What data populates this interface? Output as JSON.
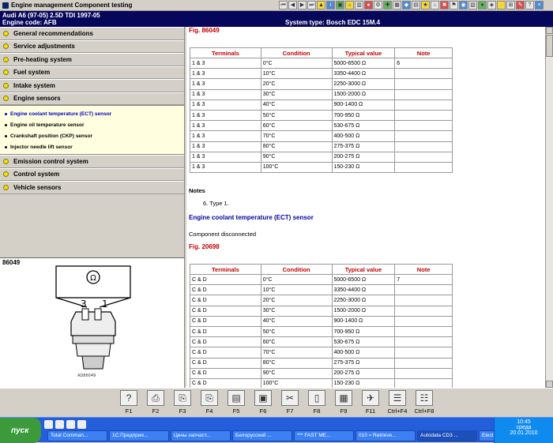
{
  "window": {
    "title": "Engine management Component testing"
  },
  "vehicle": {
    "line1": "Audi   A6 (97-05) 2.5D TDI 1997-05",
    "line2": "Engine code: AFB",
    "system_type": "System type: Bosch EDC 15M.4"
  },
  "nav": {
    "items_top": [
      {
        "label": "General recommendations"
      },
      {
        "label": "Service adjustments"
      },
      {
        "label": "Pre-heating system"
      },
      {
        "label": "Fuel system"
      },
      {
        "label": "Intake system"
      },
      {
        "label": "Engine sensors"
      }
    ],
    "subitems": [
      {
        "label": "Engine coolant temperature (ECT) sensor"
      },
      {
        "label": "Engine oil temperature sensor"
      },
      {
        "label": "Crankshaft position (CKP) sensor"
      },
      {
        "label": "Injector needle lift sensor"
      }
    ],
    "items_bottom": [
      {
        "label": "Emission control system"
      },
      {
        "label": "Control system"
      },
      {
        "label": "Vehicle sensors"
      }
    ]
  },
  "figure_panel": {
    "label": "86049",
    "pin3": "3",
    "pin1": "1",
    "ohm": "Ω",
    "caption": "AD86049"
  },
  "content": {
    "fig1": "Fig. 86049",
    "table1": {
      "headers": [
        "Terminals",
        "Condition",
        "Typical value",
        "Note"
      ],
      "rows": [
        [
          "1 & 3",
          "0°C",
          "5000-6500 Ω",
          "6"
        ],
        [
          "1 & 3",
          "10°C",
          "3350-4400 Ω",
          ""
        ],
        [
          "1 & 3",
          "20°C",
          "2250-3000 Ω",
          ""
        ],
        [
          "1 & 3",
          "30°C",
          "1500-2000 Ω",
          ""
        ],
        [
          "1 & 3",
          "40°C",
          "900-1400 Ω",
          ""
        ],
        [
          "1 & 3",
          "50°C",
          "700-950 Ω",
          ""
        ],
        [
          "1 & 3",
          "60°C",
          "530-675 Ω",
          ""
        ],
        [
          "1 & 3",
          "70°C",
          "400-500 Ω",
          ""
        ],
        [
          "1 & 3",
          "80°C",
          "275-375 Ω",
          ""
        ],
        [
          "1 & 3",
          "90°C",
          "200-275 Ω",
          ""
        ],
        [
          "1 & 3",
          "100°C",
          "150-230 Ω",
          ""
        ]
      ]
    },
    "notes_heading": "Notes",
    "note_item": "6. Type 1.",
    "section_heading": "Engine coolant temperature (ECT) sensor",
    "component_text": "Component disconnected",
    "fig2": "Fig. 20698",
    "table2": {
      "headers": [
        "Terminals",
        "Condition",
        "Typical value",
        "Note"
      ],
      "rows": [
        [
          "C & D",
          "0°C",
          "5000-6500 Ω",
          "7"
        ],
        [
          "C & D",
          "10°C",
          "3350-4400 Ω",
          ""
        ],
        [
          "C & D",
          "20°C",
          "2250-3000 Ω",
          ""
        ],
        [
          "C & D",
          "30°C",
          "1500-2000 Ω",
          ""
        ],
        [
          "C & D",
          "40°C",
          "900-1400 Ω",
          ""
        ],
        [
          "C & D",
          "50°C",
          "700-950 Ω",
          ""
        ],
        [
          "C & D",
          "60°C",
          "530-675 Ω",
          ""
        ],
        [
          "C & D",
          "70°C",
          "400-500 Ω",
          ""
        ],
        [
          "C & D",
          "80°C",
          "275-375 Ω",
          ""
        ],
        [
          "C & D",
          "90°C",
          "200-275 Ω",
          ""
        ],
        [
          "C & D",
          "100°C",
          "150-230 Ω",
          ""
        ]
      ]
    }
  },
  "fkeys": [
    {
      "label": "F1",
      "icon": "?"
    },
    {
      "label": "F2",
      "icon": "⎙"
    },
    {
      "label": "F3",
      "icon": "⎘"
    },
    {
      "label": "F4",
      "icon": "⎘"
    },
    {
      "label": "F5",
      "icon": "▤"
    },
    {
      "label": "F6",
      "icon": "▣"
    },
    {
      "label": "F7",
      "icon": "✂"
    },
    {
      "label": "F8",
      "icon": "▯"
    },
    {
      "label": "F9",
      "icon": "▦"
    },
    {
      "label": "F11",
      "icon": "✈"
    },
    {
      "label": "Ctrl+F4",
      "icon": "☰"
    },
    {
      "label": "Ctrl+F8",
      "icon": "☷"
    }
  ],
  "taskbar": {
    "start": "пуск",
    "tasks": [
      "Total Comman...",
      "1С:Предприя...",
      "Цены запчаст...",
      "Белорусский ...",
      "*** FAST ME...",
      "010 ≈ Retrieve...",
      "Autodata CD3 ...",
      "Electronic Servi..."
    ],
    "time": "10:45",
    "day": "среда",
    "date": "20.01.2010"
  }
}
